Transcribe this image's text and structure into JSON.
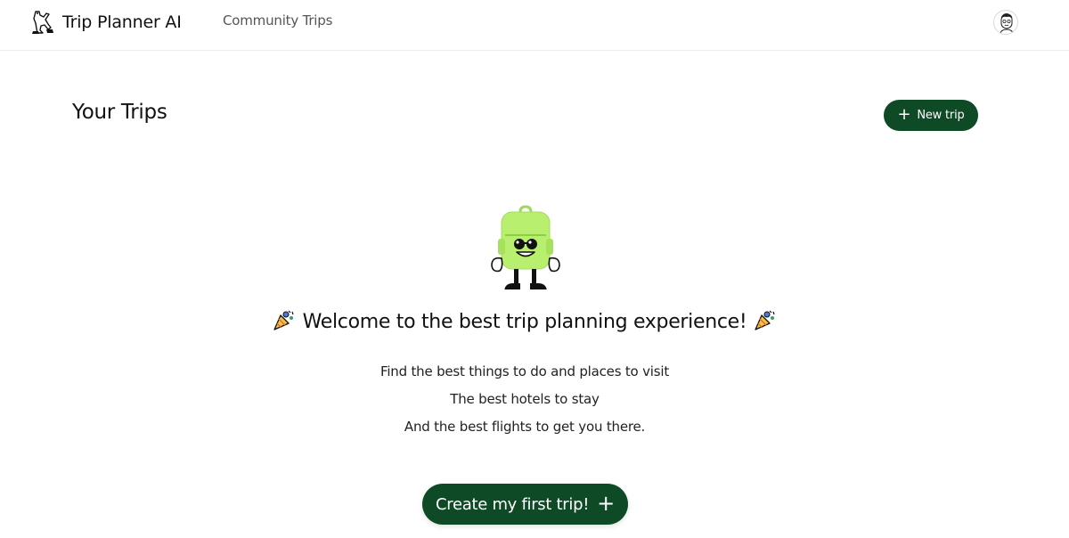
{
  "header": {
    "app_name": "Trip Planner AI",
    "nav_link": "Community Trips",
    "logo_icon": "walking-figure-icon",
    "avatar_icon": "user-avatar-icon"
  },
  "main": {
    "title": "Your Trips",
    "new_trip_label": "New trip",
    "welcome": "Welcome to the best trip planning experience!",
    "lines": [
      "Find the best things to do and places to visit",
      "The best hotels to stay",
      "And the best flights to get you there."
    ],
    "cta_label": "Create my first trip!",
    "mascot_icon": "backpack-mascot-icon",
    "party_icon": "party-popper-icon"
  },
  "colors": {
    "brand_green": "#0d4a25",
    "mascot_green": "#b9ef6f",
    "text": "#111111"
  }
}
